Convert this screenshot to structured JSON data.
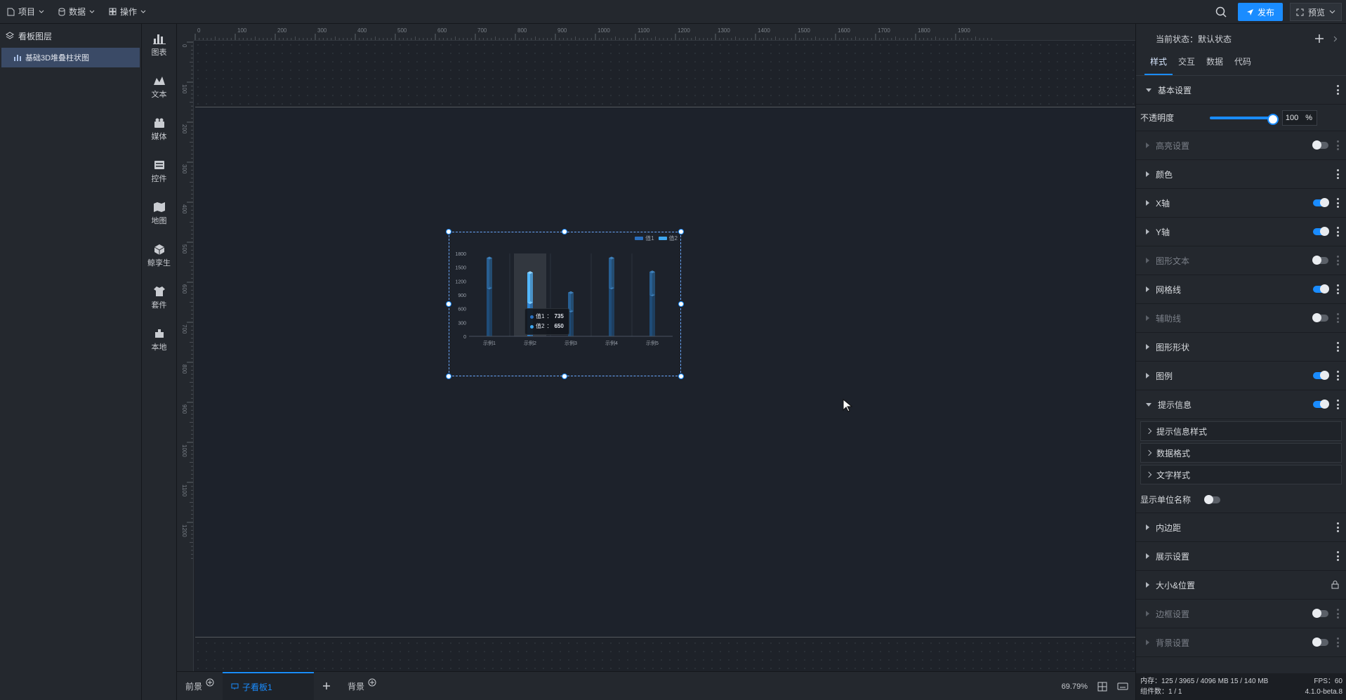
{
  "topbar": {
    "menus": [
      {
        "label": "项目"
      },
      {
        "label": "数据"
      },
      {
        "label": "操作"
      }
    ],
    "publish_label": "发布",
    "preview_label": "预览"
  },
  "layers": {
    "title": "看板图层",
    "items": [
      {
        "label": "基础3D堆叠柱状图"
      }
    ]
  },
  "components": [
    {
      "label": "图表",
      "icon": "bar-chart-icon"
    },
    {
      "label": "文本",
      "icon": "text-icon"
    },
    {
      "label": "媒体",
      "icon": "media-icon"
    },
    {
      "label": "控件",
      "icon": "control-icon"
    },
    {
      "label": "地图",
      "icon": "map-icon"
    },
    {
      "label": "鲸孪生",
      "icon": "twin-icon"
    },
    {
      "label": "套件",
      "icon": "kit-icon"
    },
    {
      "label": "本地",
      "icon": "local-icon"
    }
  ],
  "ruler": {
    "h_ticks": [
      "0",
      "100",
      "200",
      "300",
      "400",
      "500",
      "600",
      "700",
      "800",
      "900",
      "1000",
      "1100",
      "1200",
      "1300",
      "1400",
      "1500",
      "1600",
      "1700",
      "1800",
      "1900"
    ],
    "v_ticks": [
      "0",
      "100",
      "200",
      "300",
      "400",
      "500",
      "600",
      "700",
      "800",
      "900",
      "1000",
      "1100",
      "1200"
    ]
  },
  "chart_data": {
    "type": "bar",
    "stacked": true,
    "categories": [
      "示例1",
      "示例2",
      "示例3",
      "示例4",
      "示例5"
    ],
    "series": [
      {
        "name": "值1",
        "values": [
          1050,
          735,
          550,
          1050,
          900
        ]
      },
      {
        "name": "值2",
        "values": [
          650,
          650,
          400,
          650,
          500
        ]
      }
    ],
    "y_ticks": [
      "0",
      "300",
      "600",
      "900",
      "1200",
      "1500",
      "1800"
    ],
    "ylim": [
      0,
      1800
    ],
    "legend_position": "top-right",
    "highlight_index": 1,
    "tooltip": {
      "rows": [
        {
          "name": "值1",
          "value": "735"
        },
        {
          "name": "值2",
          "value": "650"
        }
      ]
    },
    "colors": {
      "series1": "#2a6fbf",
      "series2": "#3fa7f0"
    }
  },
  "bottombar": {
    "tabs": [
      {
        "label": "前景"
      },
      {
        "label": "子看板1"
      },
      {
        "label": "背景"
      }
    ],
    "zoom": "69.79%"
  },
  "panel": {
    "state_label": "当前状态：默认状态",
    "tabs": [
      "样式",
      "交互",
      "数据",
      "代码"
    ],
    "basic_label": "基本设置",
    "opacity_label": "不透明度",
    "opacity_value": "100",
    "opacity_unit": "%",
    "sections_a": [
      {
        "label": "高亮设置",
        "toggle": "off",
        "dim": true
      },
      {
        "label": "颜色",
        "toggle": "none",
        "dim": false
      },
      {
        "label": "X轴",
        "toggle": "on",
        "dim": false
      },
      {
        "label": "Y轴",
        "toggle": "on",
        "dim": false
      },
      {
        "label": "图形文本",
        "toggle": "off",
        "dim": true
      },
      {
        "label": "网格线",
        "toggle": "on",
        "dim": false
      },
      {
        "label": "辅助线",
        "toggle": "off",
        "dim": true
      },
      {
        "label": "图形形状",
        "toggle": "none",
        "dim": false
      },
      {
        "label": "图例",
        "toggle": "on",
        "dim": false
      }
    ],
    "tip_label": "提示信息",
    "tip_subs": [
      "提示信息样式",
      "数据格式",
      "文字样式"
    ],
    "unit_label": "显示单位名称",
    "sections_b": [
      {
        "label": "内边距",
        "toggle": "none",
        "dim": false
      },
      {
        "label": "展示设置",
        "toggle": "none",
        "dim": false
      },
      {
        "label": "大小&位置",
        "toggle": "lock",
        "dim": false
      },
      {
        "label": "边框设置",
        "toggle": "off",
        "dim": true
      },
      {
        "label": "背景设置",
        "toggle": "off",
        "dim": true
      }
    ],
    "status": {
      "memory": "内存：125 / 3965 / 4096 MB  15 / 140 MB",
      "fps": "FPS：60",
      "count": "组件数：1 / 1",
      "version": "4.1.0-beta.8"
    }
  }
}
